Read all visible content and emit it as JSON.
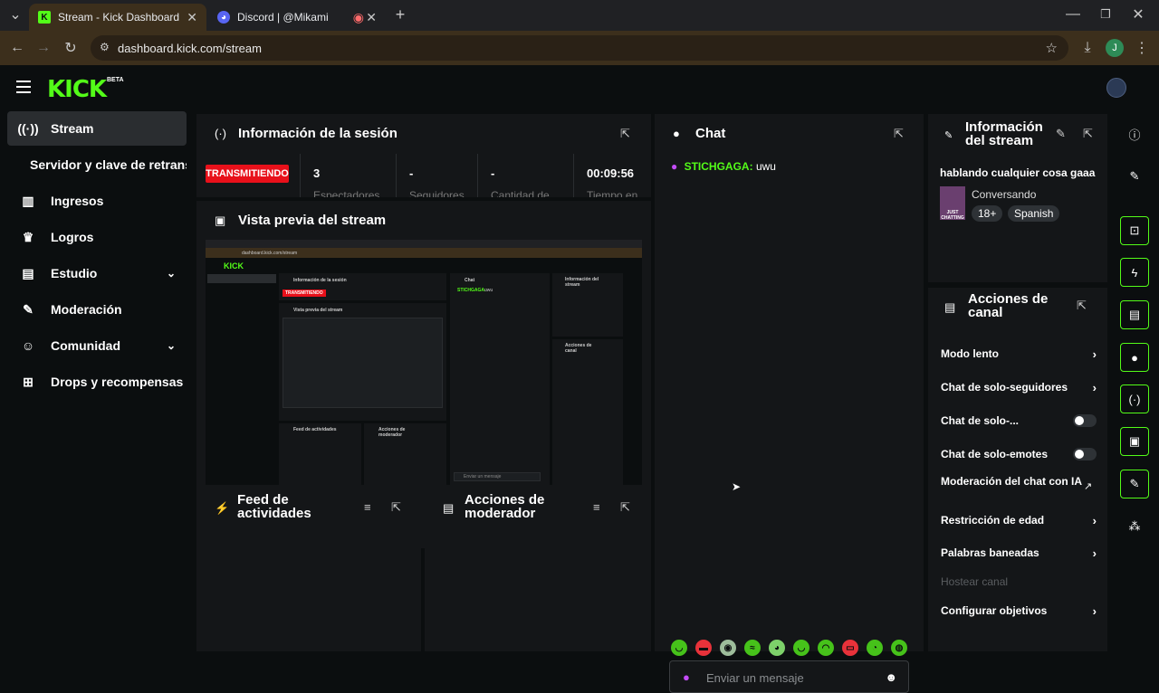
{
  "browser": {
    "tabs": [
      {
        "label": "Stream - Kick Dashboard",
        "active": true
      },
      {
        "label": "Discord | @Mikami",
        "active": false
      }
    ],
    "url": "dashboard.kick.com/stream",
    "profile_initial": "J"
  },
  "app": {
    "logo": "KICK",
    "logo_badge": "BETA"
  },
  "sidebar": {
    "items": [
      {
        "label": "Stream",
        "icon": "broadcast-icon"
      },
      {
        "label": "Servidor y clave de retransn",
        "icon": ""
      },
      {
        "label": "Ingresos",
        "icon": "chart-icon"
      },
      {
        "label": "Logros",
        "icon": "trophy-icon"
      },
      {
        "label": "Estudio",
        "icon": "studio-icon"
      },
      {
        "label": "Moderación",
        "icon": "wrench-icon"
      },
      {
        "label": "Comunidad",
        "icon": "community-icon"
      },
      {
        "label": "Drops y recompensas",
        "icon": "gift-icon"
      }
    ]
  },
  "session": {
    "title": "Información de la sesión",
    "status": "TRANSMITIENDO",
    "stats": [
      {
        "value": "3",
        "label": "Espectadores"
      },
      {
        "value": "-",
        "label": "Seguidores"
      },
      {
        "value": "-",
        "label": "Cantidad de"
      },
      {
        "value": "00:09:56",
        "label": "Tiempo en"
      }
    ]
  },
  "preview": {
    "title": "Vista previa del stream",
    "mini_url": "dashboard.kick.com/stream",
    "mini_session": "Información de la sesión",
    "mini_status": "TRANSMITIENDO",
    "mini_preview": "Vista previa del stream",
    "mini_chat": "Chat",
    "mini_chat_user": "STICHGAGA:",
    "mini_chat_msg": "uwu",
    "mini_feed": "Feed de actividades",
    "mini_mod": "Acciones de moderador",
    "mini_info": "Información del stream",
    "mini_actions": "Acciones de canal",
    "mini_input": "Enviar un mensaje"
  },
  "feed": {
    "title": "Feed de actividades"
  },
  "modactions": {
    "title": "Acciones de moderador"
  },
  "chat": {
    "title": "Chat",
    "messages": [
      {
        "user": "STICHGAGA:",
        "text": "uwu"
      }
    ],
    "input_placeholder": "Enviar un mensaje"
  },
  "stream_info": {
    "title_line1": "Información",
    "title_line2": "del stream",
    "stream_title": "hablando cualquier cosa gaaa",
    "category": "Conversando",
    "thumb_text": "JUST CHATTING",
    "tags": [
      "18+",
      "Spanish"
    ]
  },
  "channel_actions": {
    "title_line1": "Acciones de",
    "title_line2": "canal",
    "items": [
      {
        "label": "Modo lento",
        "control": "chevron"
      },
      {
        "label": "Chat de solo-seguidores",
        "control": "chevron"
      },
      {
        "label": "Chat de solo-...",
        "control": "toggle",
        "enabled": false
      },
      {
        "label": "Chat de solo-emotes",
        "control": "toggle",
        "enabled": false
      },
      {
        "label": "Moderación del chat con IA",
        "control": "external"
      },
      {
        "label": "Restricción de edad",
        "control": "chevron"
      },
      {
        "label": "Palabras baneadas",
        "control": "chevron"
      },
      {
        "label": "Hostear canal",
        "control": "none",
        "disabled": true
      },
      {
        "label": "Configurar objetivos",
        "control": "chevron"
      }
    ]
  },
  "colors": {
    "kick_green": "#53fc18",
    "live_red": "#e8101a",
    "panel_bg": "#141618",
    "page_bg": "#0b0e0f"
  }
}
